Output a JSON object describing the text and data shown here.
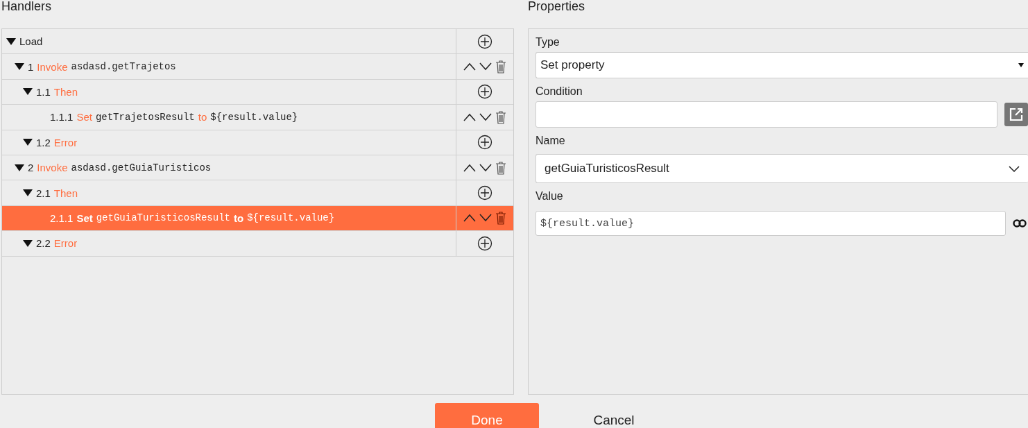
{
  "handlers": {
    "title": "Handlers",
    "tree": [
      {
        "name": "Load",
        "expanded": true,
        "selected": false,
        "kind": "container",
        "children": [
          {
            "number": "1",
            "keyword": "Invoke",
            "target": "asdasd.getTrajetos",
            "expanded": true,
            "selected": false,
            "kind": "step",
            "children": [
              {
                "number": "1.1",
                "keyword": "Then",
                "expanded": true,
                "selected": false,
                "kind": "container",
                "children": [
                  {
                    "number": "1.1.1",
                    "keyword": "Set",
                    "target": "getTrajetosResult",
                    "connector": "to",
                    "value": "${result.value}",
                    "selected": false,
                    "kind": "step"
                  }
                ]
              },
              {
                "number": "1.2",
                "keyword": "Error",
                "expanded": true,
                "selected": false,
                "kind": "container"
              }
            ]
          },
          {
            "number": "2",
            "keyword": "Invoke",
            "target": "asdasd.getGuiaTuristicos",
            "expanded": true,
            "selected": false,
            "kind": "step",
            "children": [
              {
                "number": "2.1",
                "keyword": "Then",
                "expanded": true,
                "selected": false,
                "kind": "container",
                "children": [
                  {
                    "number": "2.1.1",
                    "keyword": "Set",
                    "target": "getGuiaTuristicosResult",
                    "connector": "to",
                    "value": "${result.value}",
                    "selected": true,
                    "kind": "step"
                  }
                ]
              },
              {
                "number": "2.2",
                "keyword": "Error",
                "expanded": true,
                "selected": false,
                "kind": "container"
              }
            ]
          }
        ]
      }
    ]
  },
  "properties": {
    "title": "Properties",
    "type": {
      "label": "Type",
      "value": "Set property"
    },
    "condition": {
      "label": "Condition"
    },
    "name": {
      "label": "Name",
      "value": "getGuiaTuristicosResult"
    },
    "value": {
      "label": "Value",
      "value": "${result.value}"
    }
  },
  "buttons": [
    {
      "label": "Done",
      "kind": "primary"
    },
    {
      "label": "Cancel",
      "kind": "plain"
    }
  ]
}
